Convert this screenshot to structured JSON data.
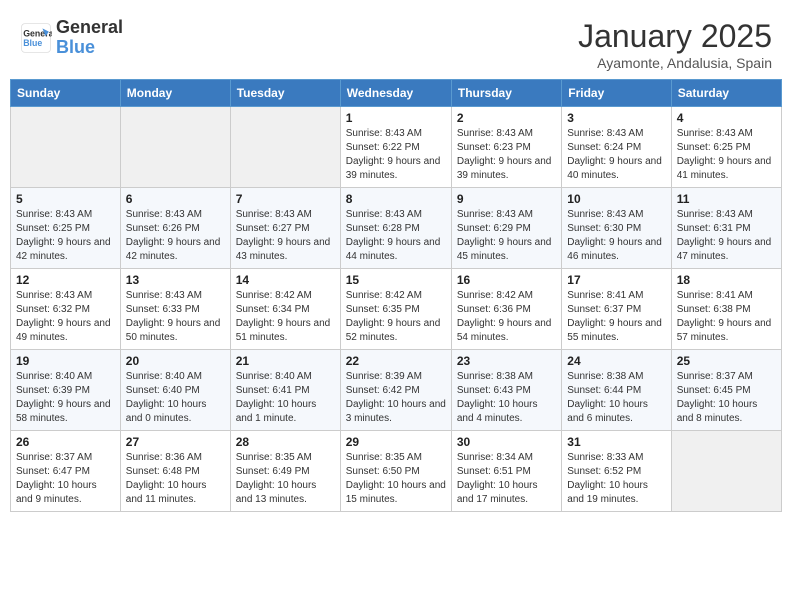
{
  "header": {
    "logo_line1": "General",
    "logo_line2": "Blue",
    "month_year": "January 2025",
    "location": "Ayamonte, Andalusia, Spain"
  },
  "weekdays": [
    "Sunday",
    "Monday",
    "Tuesday",
    "Wednesday",
    "Thursday",
    "Friday",
    "Saturday"
  ],
  "weeks": [
    [
      {
        "day": "",
        "info": ""
      },
      {
        "day": "",
        "info": ""
      },
      {
        "day": "",
        "info": ""
      },
      {
        "day": "1",
        "info": "Sunrise: 8:43 AM\nSunset: 6:22 PM\nDaylight: 9 hours and 39 minutes."
      },
      {
        "day": "2",
        "info": "Sunrise: 8:43 AM\nSunset: 6:23 PM\nDaylight: 9 hours and 39 minutes."
      },
      {
        "day": "3",
        "info": "Sunrise: 8:43 AM\nSunset: 6:24 PM\nDaylight: 9 hours and 40 minutes."
      },
      {
        "day": "4",
        "info": "Sunrise: 8:43 AM\nSunset: 6:25 PM\nDaylight: 9 hours and 41 minutes."
      }
    ],
    [
      {
        "day": "5",
        "info": "Sunrise: 8:43 AM\nSunset: 6:25 PM\nDaylight: 9 hours and 42 minutes."
      },
      {
        "day": "6",
        "info": "Sunrise: 8:43 AM\nSunset: 6:26 PM\nDaylight: 9 hours and 42 minutes."
      },
      {
        "day": "7",
        "info": "Sunrise: 8:43 AM\nSunset: 6:27 PM\nDaylight: 9 hours and 43 minutes."
      },
      {
        "day": "8",
        "info": "Sunrise: 8:43 AM\nSunset: 6:28 PM\nDaylight: 9 hours and 44 minutes."
      },
      {
        "day": "9",
        "info": "Sunrise: 8:43 AM\nSunset: 6:29 PM\nDaylight: 9 hours and 45 minutes."
      },
      {
        "day": "10",
        "info": "Sunrise: 8:43 AM\nSunset: 6:30 PM\nDaylight: 9 hours and 46 minutes."
      },
      {
        "day": "11",
        "info": "Sunrise: 8:43 AM\nSunset: 6:31 PM\nDaylight: 9 hours and 47 minutes."
      }
    ],
    [
      {
        "day": "12",
        "info": "Sunrise: 8:43 AM\nSunset: 6:32 PM\nDaylight: 9 hours and 49 minutes."
      },
      {
        "day": "13",
        "info": "Sunrise: 8:43 AM\nSunset: 6:33 PM\nDaylight: 9 hours and 50 minutes."
      },
      {
        "day": "14",
        "info": "Sunrise: 8:42 AM\nSunset: 6:34 PM\nDaylight: 9 hours and 51 minutes."
      },
      {
        "day": "15",
        "info": "Sunrise: 8:42 AM\nSunset: 6:35 PM\nDaylight: 9 hours and 52 minutes."
      },
      {
        "day": "16",
        "info": "Sunrise: 8:42 AM\nSunset: 6:36 PM\nDaylight: 9 hours and 54 minutes."
      },
      {
        "day": "17",
        "info": "Sunrise: 8:41 AM\nSunset: 6:37 PM\nDaylight: 9 hours and 55 minutes."
      },
      {
        "day": "18",
        "info": "Sunrise: 8:41 AM\nSunset: 6:38 PM\nDaylight: 9 hours and 57 minutes."
      }
    ],
    [
      {
        "day": "19",
        "info": "Sunrise: 8:40 AM\nSunset: 6:39 PM\nDaylight: 9 hours and 58 minutes."
      },
      {
        "day": "20",
        "info": "Sunrise: 8:40 AM\nSunset: 6:40 PM\nDaylight: 10 hours and 0 minutes."
      },
      {
        "day": "21",
        "info": "Sunrise: 8:40 AM\nSunset: 6:41 PM\nDaylight: 10 hours and 1 minute."
      },
      {
        "day": "22",
        "info": "Sunrise: 8:39 AM\nSunset: 6:42 PM\nDaylight: 10 hours and 3 minutes."
      },
      {
        "day": "23",
        "info": "Sunrise: 8:38 AM\nSunset: 6:43 PM\nDaylight: 10 hours and 4 minutes."
      },
      {
        "day": "24",
        "info": "Sunrise: 8:38 AM\nSunset: 6:44 PM\nDaylight: 10 hours and 6 minutes."
      },
      {
        "day": "25",
        "info": "Sunrise: 8:37 AM\nSunset: 6:45 PM\nDaylight: 10 hours and 8 minutes."
      }
    ],
    [
      {
        "day": "26",
        "info": "Sunrise: 8:37 AM\nSunset: 6:47 PM\nDaylight: 10 hours and 9 minutes."
      },
      {
        "day": "27",
        "info": "Sunrise: 8:36 AM\nSunset: 6:48 PM\nDaylight: 10 hours and 11 minutes."
      },
      {
        "day": "28",
        "info": "Sunrise: 8:35 AM\nSunset: 6:49 PM\nDaylight: 10 hours and 13 minutes."
      },
      {
        "day": "29",
        "info": "Sunrise: 8:35 AM\nSunset: 6:50 PM\nDaylight: 10 hours and 15 minutes."
      },
      {
        "day": "30",
        "info": "Sunrise: 8:34 AM\nSunset: 6:51 PM\nDaylight: 10 hours and 17 minutes."
      },
      {
        "day": "31",
        "info": "Sunrise: 8:33 AM\nSunset: 6:52 PM\nDaylight: 10 hours and 19 minutes."
      },
      {
        "day": "",
        "info": ""
      }
    ]
  ]
}
